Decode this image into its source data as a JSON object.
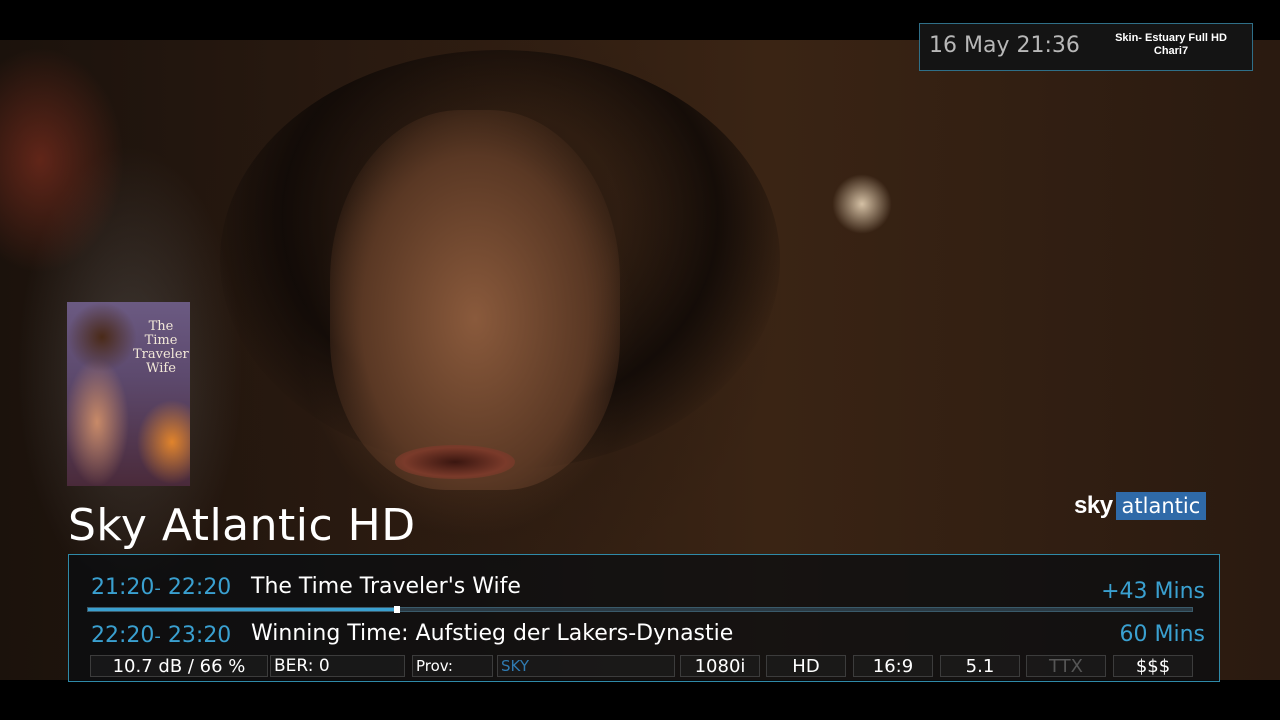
{
  "clock": {
    "datetime": "16 May 21:36",
    "skin_line1": "Skin- Estuary Full HD",
    "skin_line2": "Chari7"
  },
  "poster": {
    "title_line1": "The Time",
    "title_line2": "Traveler's",
    "title_line3": "Wife"
  },
  "channel": {
    "name": "Sky Atlantic HD",
    "logo_sky": "sky",
    "logo_atlantic": "atlantic"
  },
  "now": {
    "start": "21:20",
    "sep": "-",
    "end": "22:20",
    "title": "The Time Traveler's Wife",
    "remaining": "+43 Mins",
    "progress_percent": 28
  },
  "next": {
    "start": "22:20",
    "sep": "-",
    "end": "23:20",
    "title": "Winning Time: Aufstieg der Lakers-Dynastie",
    "duration": "60 Mins"
  },
  "info": {
    "signal": "10.7 dB /  66 %",
    "ber": "BER: 0",
    "prov_label": "Prov:",
    "prov_value": "SKY",
    "resolution": "1080i",
    "hd": "HD",
    "aspect": "16:9",
    "audio": "5.1",
    "ttx": "TTX",
    "crypt": "$$$"
  },
  "colors": {
    "accent": "#3aa0d0",
    "border": "#2f8aa8",
    "logo_blue": "#2f6aa8"
  }
}
